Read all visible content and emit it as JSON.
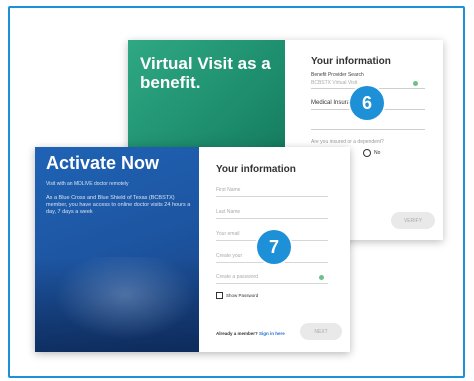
{
  "back_card": {
    "title": "Virtual Visit as a benefit.",
    "heading": "Your information",
    "field1_label": "Benefit Provider Search",
    "field1_value": "BCBSTX Virtual Visit",
    "field2_value": "Medical Insurance",
    "question": "Are you insured or a dependent?",
    "option_no": "No",
    "button": "VERIFY"
  },
  "front_card": {
    "title": "Activate Now",
    "subtitle": "Visit with an MDLIVE doctor remotely",
    "body": "As a Blue Cross and Blue Shield of Texas (BCBSTX) member, you have access to online doctor visits 24 hours a day, 7 days a week",
    "heading": "Your information",
    "placeholders": [
      "First Name",
      "Last Name",
      "Your email",
      "Create your",
      "Create a password"
    ],
    "show_password": "Show Password",
    "already_member": "Already a member?",
    "sign_in": "Sign in here",
    "button": "NEXT"
  },
  "badges": {
    "back": "6",
    "front": "7"
  },
  "colors": {
    "frame": "#1e90d8",
    "back_panel": "#1b8a6a",
    "front_panel": "#1d55a1"
  }
}
